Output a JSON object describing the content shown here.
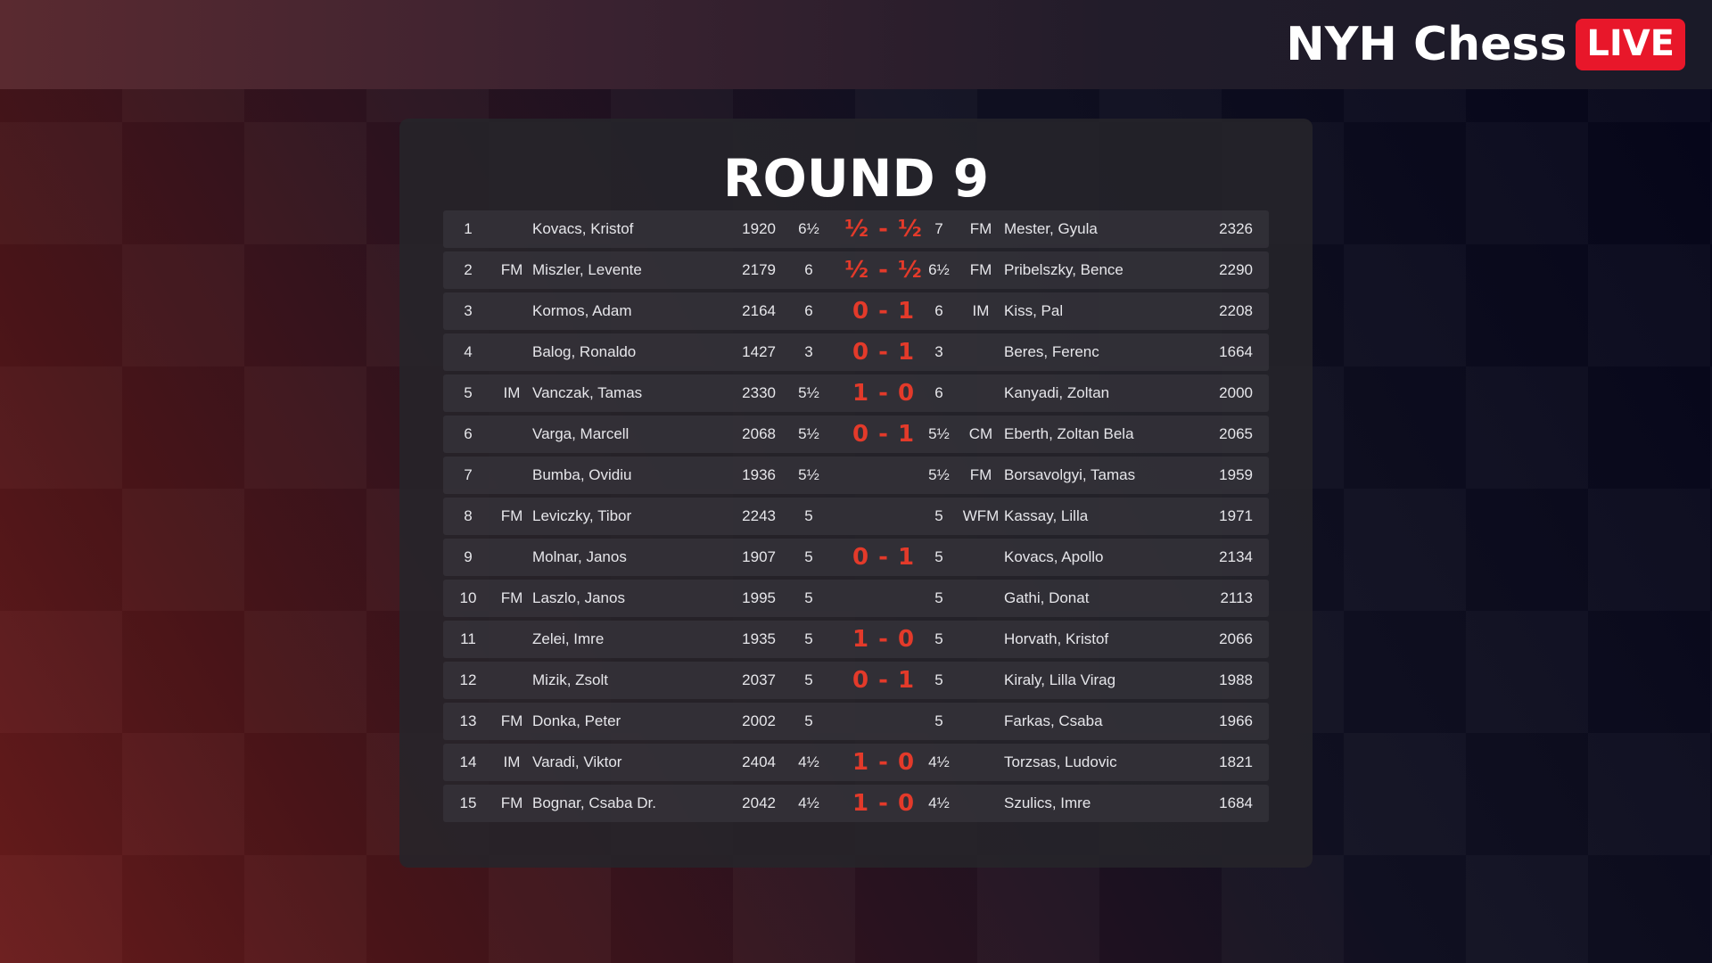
{
  "brand": {
    "name": "NYH Chess",
    "live_label": "LIVE"
  },
  "round_title": "ROUND 9",
  "colors": {
    "accent_red": "#e8172a",
    "result_red": "#e33a2a"
  },
  "pairings": [
    {
      "board": "1",
      "white_title": "",
      "white_name": "Kovacs, Kristof",
      "white_rating": "1920",
      "white_points": "6½",
      "result": "½ - ½",
      "black_points": "7",
      "black_title": "FM",
      "black_name": "Mester, Gyula",
      "black_rating": "2326"
    },
    {
      "board": "2",
      "white_title": "FM",
      "white_name": "Miszler, Levente",
      "white_rating": "2179",
      "white_points": "6",
      "result": "½ - ½",
      "black_points": "6½",
      "black_title": "FM",
      "black_name": "Pribelszky, Bence",
      "black_rating": "2290"
    },
    {
      "board": "3",
      "white_title": "",
      "white_name": "Kormos, Adam",
      "white_rating": "2164",
      "white_points": "6",
      "result": "0 - 1",
      "black_points": "6",
      "black_title": "IM",
      "black_name": "Kiss, Pal",
      "black_rating": "2208"
    },
    {
      "board": "4",
      "white_title": "",
      "white_name": "Balog, Ronaldo",
      "white_rating": "1427",
      "white_points": "3",
      "result": "0 - 1",
      "black_points": "3",
      "black_title": "",
      "black_name": "Beres, Ferenc",
      "black_rating": "1664"
    },
    {
      "board": "5",
      "white_title": "IM",
      "white_name": "Vanczak, Tamas",
      "white_rating": "2330",
      "white_points": "5½",
      "result": "1 - 0",
      "black_points": "6",
      "black_title": "",
      "black_name": "Kanyadi, Zoltan",
      "black_rating": "2000"
    },
    {
      "board": "6",
      "white_title": "",
      "white_name": "Varga, Marcell",
      "white_rating": "2068",
      "white_points": "5½",
      "result": "0 - 1",
      "black_points": "5½",
      "black_title": "CM",
      "black_name": "Eberth, Zoltan Bela",
      "black_rating": "2065"
    },
    {
      "board": "7",
      "white_title": "",
      "white_name": "Bumba, Ovidiu",
      "white_rating": "1936",
      "white_points": "5½",
      "result": "",
      "black_points": "5½",
      "black_title": "FM",
      "black_name": "Borsavolgyi, Tamas",
      "black_rating": "1959"
    },
    {
      "board": "8",
      "white_title": "FM",
      "white_name": "Leviczky, Tibor",
      "white_rating": "2243",
      "white_points": "5",
      "result": "",
      "black_points": "5",
      "black_title": "WFM",
      "black_name": "Kassay, Lilla",
      "black_rating": "1971"
    },
    {
      "board": "9",
      "white_title": "",
      "white_name": "Molnar, Janos",
      "white_rating": "1907",
      "white_points": "5",
      "result": "0 - 1",
      "black_points": "5",
      "black_title": "",
      "black_name": "Kovacs, Apollo",
      "black_rating": "2134"
    },
    {
      "board": "10",
      "white_title": "FM",
      "white_name": "Laszlo, Janos",
      "white_rating": "1995",
      "white_points": "5",
      "result": "",
      "black_points": "5",
      "black_title": "",
      "black_name": "Gathi, Donat",
      "black_rating": "2113"
    },
    {
      "board": "11",
      "white_title": "",
      "white_name": "Zelei, Imre",
      "white_rating": "1935",
      "white_points": "5",
      "result": "1 - 0",
      "black_points": "5",
      "black_title": "",
      "black_name": "Horvath, Kristof",
      "black_rating": "2066"
    },
    {
      "board": "12",
      "white_title": "",
      "white_name": "Mizik, Zsolt",
      "white_rating": "2037",
      "white_points": "5",
      "result": "0 - 1",
      "black_points": "5",
      "black_title": "",
      "black_name": "Kiraly, Lilla Virag",
      "black_rating": "1988"
    },
    {
      "board": "13",
      "white_title": "FM",
      "white_name": "Donka, Peter",
      "white_rating": "2002",
      "white_points": "5",
      "result": "",
      "black_points": "5",
      "black_title": "",
      "black_name": "Farkas, Csaba",
      "black_rating": "1966"
    },
    {
      "board": "14",
      "white_title": "IM",
      "white_name": "Varadi, Viktor",
      "white_rating": "2404",
      "white_points": "4½",
      "result": "1 - 0",
      "black_points": "4½",
      "black_title": "",
      "black_name": "Torzsas, Ludovic",
      "black_rating": "1821"
    },
    {
      "board": "15",
      "white_title": "FM",
      "white_name": "Bognar, Csaba Dr.",
      "white_rating": "2042",
      "white_points": "4½",
      "result": "1 - 0",
      "black_points": "4½",
      "black_title": "",
      "black_name": "Szulics, Imre",
      "black_rating": "1684"
    }
  ]
}
